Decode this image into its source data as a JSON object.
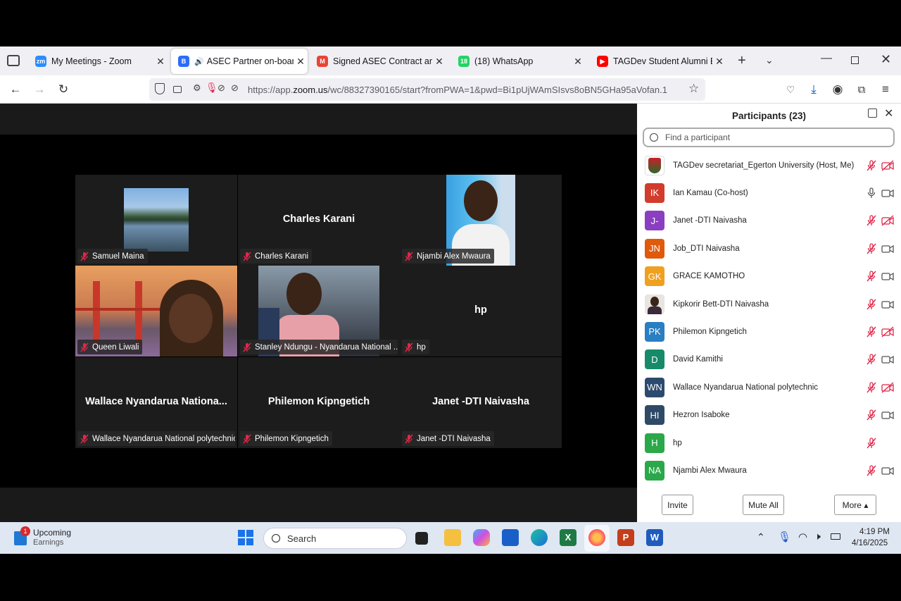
{
  "browser": {
    "tabs": [
      {
        "title": "My Meetings - Zoom",
        "fav": "zm",
        "color": "#2d8cff"
      },
      {
        "title": "ASEC Partner on-boardin",
        "fav": "B",
        "color": "#2d6df6",
        "active": true
      },
      {
        "title": "Signed ASEC Contract and Inv",
        "fav": "M",
        "color": "#ea4335"
      },
      {
        "title": "(18) WhatsApp",
        "fav": "18",
        "color": "#25d366"
      },
      {
        "title": "TAGDev Student Alumni Enter",
        "fav": "▶",
        "color": "#ff0000"
      }
    ],
    "url_prefix": "https://app.",
    "url_domain": "zoom.us",
    "url_rest": "/wc/88327390165/start?fromPWA=1&pwd=Bi1pUjWAmSIsvs8oBN5GHa95aVofan.1"
  },
  "video_tiles": [
    {
      "label": "Samuel Maina",
      "type": "lake"
    },
    {
      "label": "Charles Karani",
      "big": "Charles Karani",
      "type": "name"
    },
    {
      "label": "Njambi Alex Mwaura",
      "type": "person1"
    },
    {
      "label": "Queen Liwali",
      "type": "bridge"
    },
    {
      "label": "Stanley Ndungu - Nyandarua National ...",
      "type": "person2"
    },
    {
      "label": "hp",
      "big": "hp",
      "type": "name"
    },
    {
      "label": "Wallace Nyandarua National polytechnic",
      "big": "Wallace Nyandarua Nationa...",
      "type": "name"
    },
    {
      "label": "Philemon Kipngetich",
      "big": "Philemon Kipngetich",
      "type": "name"
    },
    {
      "label": "Janet -DTI Naivasha",
      "big": "Janet -DTI Naivasha",
      "type": "name"
    }
  ],
  "participants": {
    "title": "Participants (23)",
    "search_placeholder": "Find a participant",
    "list": [
      {
        "name": "TAGDev secretariat_Egerton University (Host, Me)",
        "initials": "",
        "color": "#ffffff",
        "mic": "off",
        "cam": "off",
        "avatar": "logo"
      },
      {
        "name": "Ian Kamau (Co-host)",
        "initials": "IK",
        "color": "#d13c2d",
        "mic": "on",
        "cam": "on"
      },
      {
        "name": "Janet -DTI Naivasha",
        "initials": "J-",
        "color": "#8a3fc0",
        "mic": "off",
        "cam": "off"
      },
      {
        "name": "Job_DTI Naivasha",
        "initials": "JN",
        "color": "#e05a0c",
        "mic": "off",
        "cam": "on"
      },
      {
        "name": "GRACE KAMOTHO",
        "initials": "GK",
        "color": "#f0a020",
        "mic": "off",
        "cam": "on"
      },
      {
        "name": "Kipkorir Bett-DTI Naivasha",
        "initials": "",
        "color": "#7a5a4a",
        "mic": "off",
        "cam": "on",
        "avatar": "photo"
      },
      {
        "name": "Philemon Kipngetich",
        "initials": "PK",
        "color": "#2a7ec2",
        "mic": "off",
        "cam": "off"
      },
      {
        "name": "David Kamithi",
        "initials": "D",
        "color": "#178a6a",
        "mic": "off",
        "cam": "on"
      },
      {
        "name": "Wallace Nyandarua National polytechnic",
        "initials": "WN",
        "color": "#2c4a6e",
        "mic": "off",
        "cam": "off"
      },
      {
        "name": "Hezron Isaboke",
        "initials": "HI",
        "color": "#2f4a66",
        "mic": "off",
        "cam": "on"
      },
      {
        "name": "hp",
        "initials": "H",
        "color": "#2aa84a",
        "mic": "off",
        "cam": "none"
      },
      {
        "name": "Njambi Alex Mwaura",
        "initials": "NA",
        "color": "#2aa84a",
        "mic": "off",
        "cam": "on"
      }
    ],
    "invite": "Invite",
    "mute_all": "Mute All",
    "more": "More ▴"
  },
  "taskbar": {
    "widget_title": "Upcoming",
    "widget_sub": "Earnings",
    "widget_badge": "1",
    "search": "Search",
    "time": "4:19 PM",
    "date": "4/16/2025"
  }
}
